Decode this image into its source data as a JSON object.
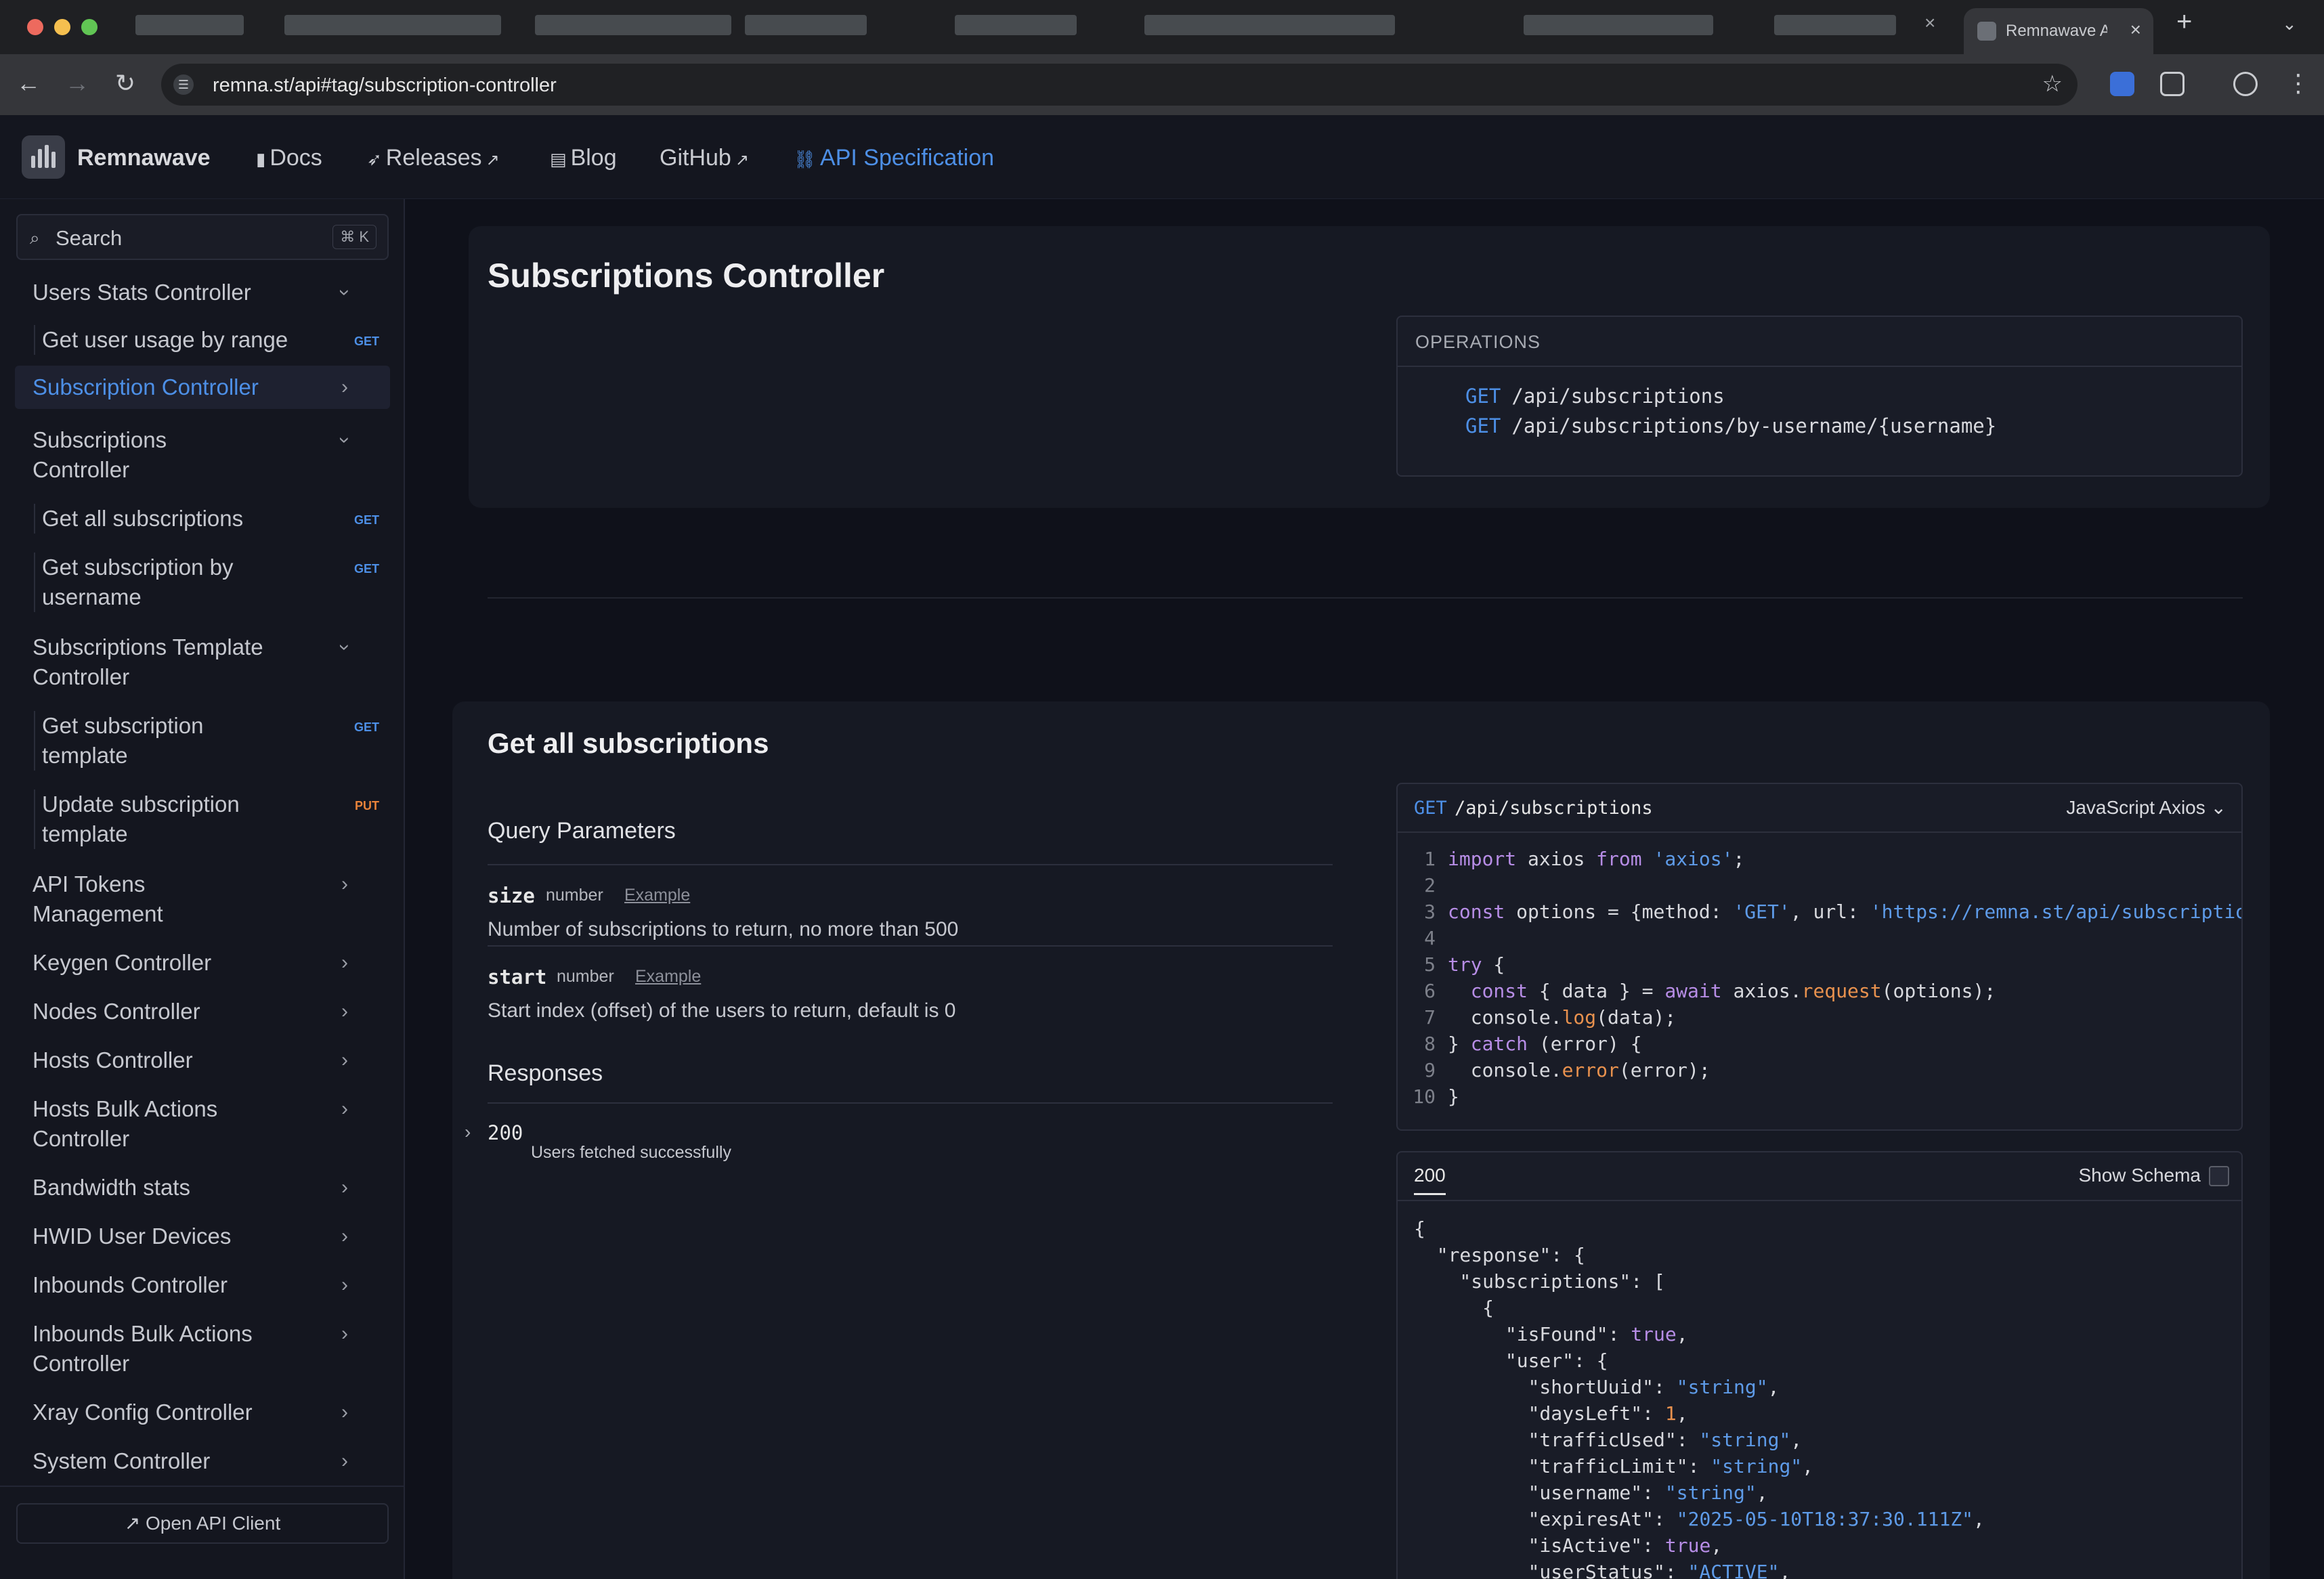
{
  "browser": {
    "active_tab_title": "Remnawave A",
    "url": "remna.st/api#tag/subscription-controller"
  },
  "header": {
    "brand": "Remnawave",
    "nav": [
      {
        "label": "Docs",
        "icon": "book-icon"
      },
      {
        "label": "Releases",
        "icon": "rocket-icon"
      },
      {
        "label": "Blog",
        "icon": "books-icon"
      },
      {
        "label": "GitHub",
        "icon": "external-link-icon"
      },
      {
        "label": "API Specification",
        "icon": "link-icon"
      }
    ]
  },
  "sidebar": {
    "search_placeholder": "Search",
    "search_shortcut": "⌘ K",
    "items": [
      {
        "label": "Users Stats Controller",
        "expanded": true
      },
      {
        "label": "Get user usage by range",
        "badge": "GET"
      },
      {
        "label": "Subscription Controller",
        "active": true
      },
      {
        "label": "Subscriptions Controller",
        "expanded": true
      },
      {
        "label": "Get all subscriptions",
        "badge": "GET"
      },
      {
        "label": "Get subscription by username",
        "badge": "GET"
      },
      {
        "label": "Subscriptions Template Controller",
        "expanded": true
      },
      {
        "label": "Get subscription template",
        "badge": "GET"
      },
      {
        "label": "Update subscription template",
        "badge": "PUT"
      },
      {
        "label": "API Tokens Management"
      },
      {
        "label": "Keygen Controller"
      },
      {
        "label": "Nodes Controller"
      },
      {
        "label": "Hosts Controller"
      },
      {
        "label": "Hosts Bulk Actions Controller"
      },
      {
        "label": "Bandwidth stats"
      },
      {
        "label": "HWID User Devices"
      },
      {
        "label": "Inbounds Controller"
      },
      {
        "label": "Inbounds Bulk Actions Controller"
      },
      {
        "label": "Xray Config Controller"
      },
      {
        "label": "System Controller"
      }
    ],
    "open_client": "Open API Client"
  },
  "tag_section": {
    "title": "Subscriptions Controller",
    "operations_title": "OPERATIONS",
    "operations": [
      {
        "method": "GET",
        "path": "/api/subscriptions"
      },
      {
        "method": "GET",
        "path": "/api/subscriptions/by-username/{username}"
      }
    ]
  },
  "operation": {
    "title": "Get all subscriptions",
    "query_title": "Query Parameters",
    "params": [
      {
        "name": "size",
        "type": "number",
        "example": "Example",
        "desc": "Number of subscriptions to return, no more than 500"
      },
      {
        "name": "start",
        "type": "number",
        "example": "Example",
        "desc": "Start index (offset) of the users to return, default is 0"
      }
    ],
    "responses_title": "Responses",
    "response": {
      "code": "200",
      "desc": "Users fetched successfully"
    },
    "request": {
      "method": "GET",
      "path": "/api/subscriptions",
      "language": "JavaScript Axios",
      "code_lines": [
        "import axios from 'axios';",
        "",
        "const options = {method: 'GET', url: 'https://remna.st/api/subscriptio",
        "",
        "try {",
        "  const { data } = await axios.request(options);",
        "  console.log(data);",
        "} catch (error) {",
        "  console.error(error);",
        "}"
      ]
    },
    "response_example": {
      "tab": "200",
      "show_schema": "Show Schema",
      "lines": [
        "{",
        "  \"response\": {",
        "    \"subscriptions\": [",
        "      {",
        "        \"isFound\": true,",
        "        \"user\": {",
        "          \"shortUuid\": \"string\",",
        "          \"daysLeft\": 1,",
        "          \"trafficUsed\": \"string\",",
        "          \"trafficLimit\": \"string\",",
        "          \"username\": \"string\",",
        "          \"expiresAt\": \"2025-05-10T18:37:30.111Z\",",
        "          \"isActive\": true,",
        "          \"userStatus\": \"ACTIVE\","
      ]
    }
  }
}
